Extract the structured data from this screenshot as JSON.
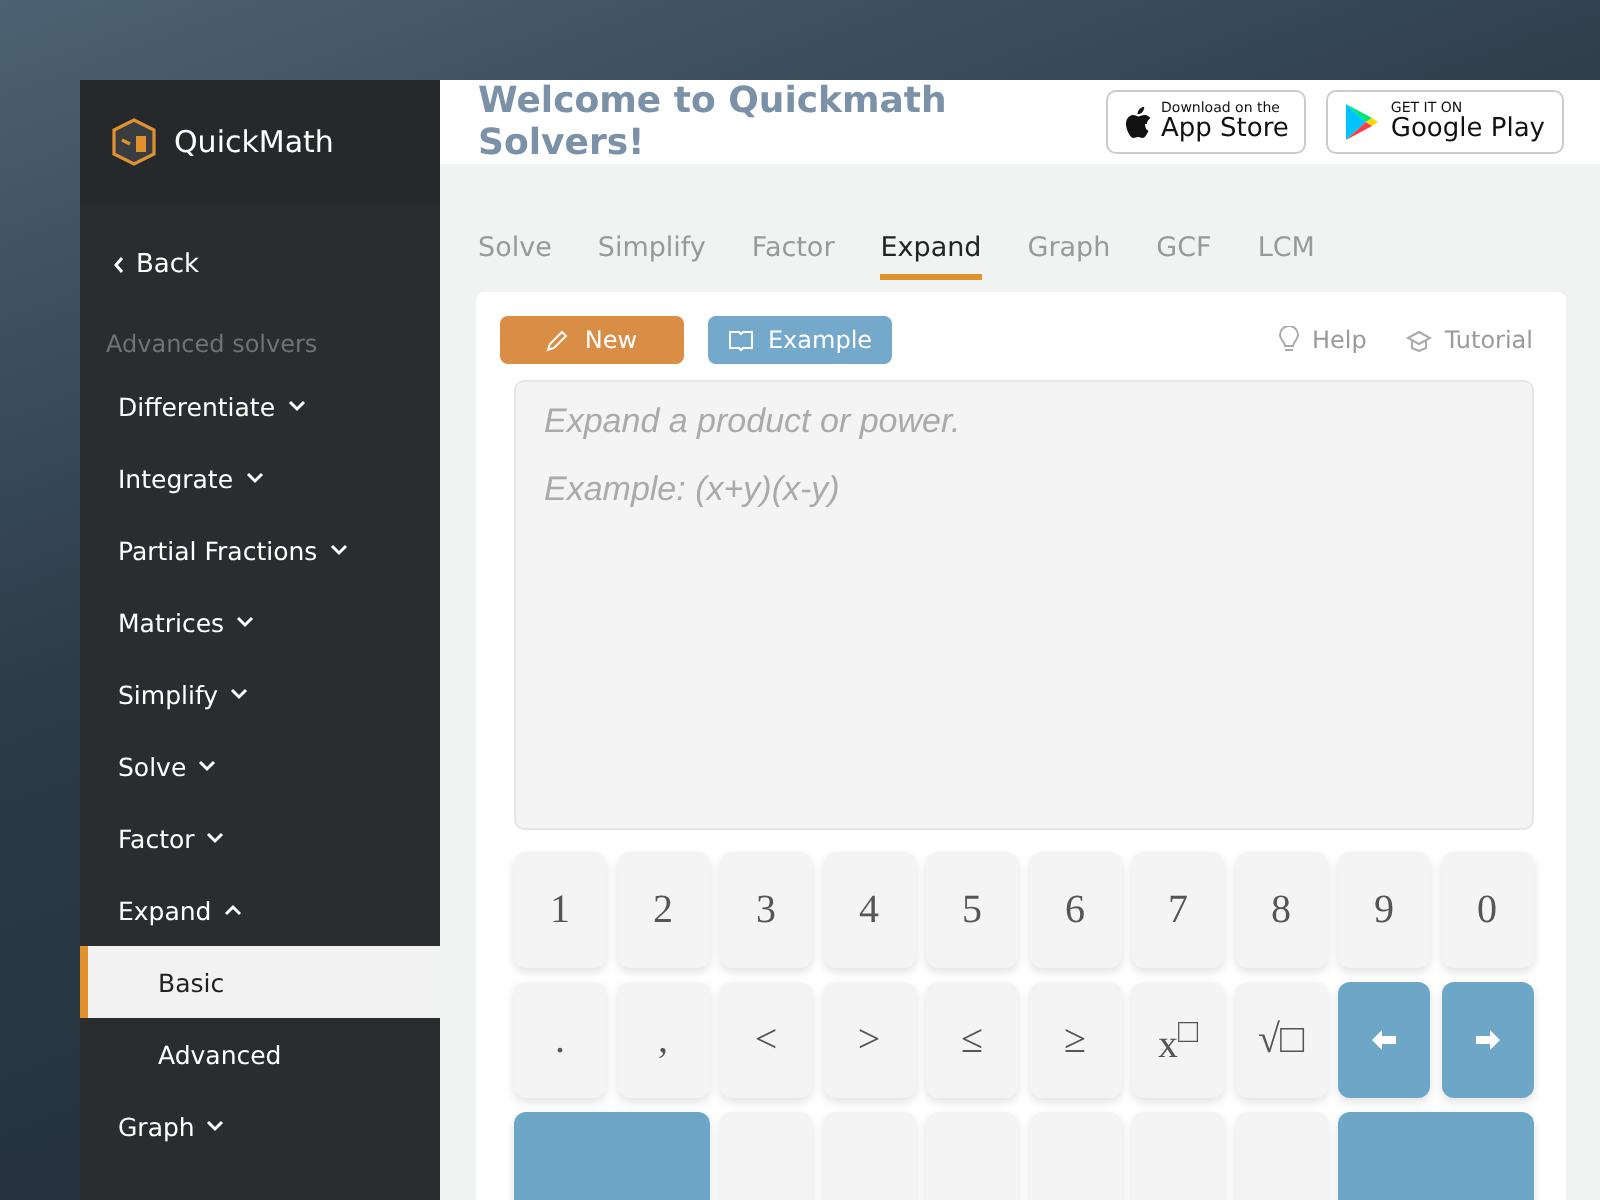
{
  "brand": {
    "name": "QuickMath"
  },
  "sidebar": {
    "back": "Back",
    "section_title": "Advanced solvers",
    "items": [
      {
        "label": "Differentiate",
        "expanded": false
      },
      {
        "label": "Integrate",
        "expanded": false
      },
      {
        "label": "Partial Fractions",
        "expanded": false
      },
      {
        "label": "Matrices",
        "expanded": false
      },
      {
        "label": "Simplify",
        "expanded": false
      },
      {
        "label": "Solve",
        "expanded": false
      },
      {
        "label": "Factor",
        "expanded": false
      },
      {
        "label": "Expand",
        "expanded": true,
        "children": [
          {
            "label": "Basic",
            "selected": true
          },
          {
            "label": "Advanced",
            "selected": false
          }
        ]
      },
      {
        "label": "Graph",
        "expanded": false
      }
    ]
  },
  "header": {
    "title": "Welcome to Quickmath Solvers!",
    "badges": [
      {
        "kind": "apple",
        "small": "Download on the",
        "big": "App Store"
      },
      {
        "kind": "google",
        "small": "GET IT ON",
        "big": "Google Play"
      }
    ]
  },
  "tabs": [
    {
      "label": "Solve",
      "selected": false
    },
    {
      "label": "Simplify",
      "selected": false
    },
    {
      "label": "Factor",
      "selected": false
    },
    {
      "label": "Expand",
      "selected": true
    },
    {
      "label": "Graph",
      "selected": false
    },
    {
      "label": "GCF",
      "selected": false
    },
    {
      "label": "LCM",
      "selected": false
    }
  ],
  "toolbar": {
    "buttons": [
      {
        "kind": "new",
        "label": "New"
      },
      {
        "kind": "example",
        "label": "Example"
      }
    ],
    "links": [
      {
        "kind": "help",
        "label": "Help"
      },
      {
        "kind": "tutorial",
        "label": "Tutorial"
      }
    ]
  },
  "editor": {
    "placeholder": "Expand a product or power.",
    "example": "Example: (x+y)(x-y)"
  },
  "keypad": [
    [
      {
        "kind": "key",
        "label": "1"
      },
      {
        "kind": "key",
        "label": "2"
      },
      {
        "kind": "key",
        "label": "3"
      },
      {
        "kind": "key",
        "label": "4"
      },
      {
        "kind": "key",
        "label": "5"
      },
      {
        "kind": "key",
        "label": "6"
      },
      {
        "kind": "key",
        "label": "7"
      },
      {
        "kind": "key",
        "label": "8"
      },
      {
        "kind": "key",
        "label": "9"
      },
      {
        "kind": "key",
        "label": "0"
      }
    ],
    [
      {
        "kind": "key",
        "label": "."
      },
      {
        "kind": "key",
        "label": ","
      },
      {
        "kind": "key",
        "label": "<"
      },
      {
        "kind": "key",
        "label": ">"
      },
      {
        "kind": "key",
        "label": "≤"
      },
      {
        "kind": "key",
        "label": "≥"
      },
      {
        "kind": "key",
        "label": "x$^{□}$"
      },
      {
        "kind": "key",
        "label": "√□"
      },
      {
        "kind": "left"
      },
      {
        "kind": "right"
      }
    ],
    [
      {
        "kind": "wide"
      },
      {
        "kind": "blank"
      },
      {
        "kind": "blank"
      },
      {
        "kind": "blank"
      },
      {
        "kind": "blank"
      },
      {
        "kind": "blank"
      },
      {
        "kind": "blank"
      },
      {
        "kind": "wide"
      }
    ]
  ]
}
